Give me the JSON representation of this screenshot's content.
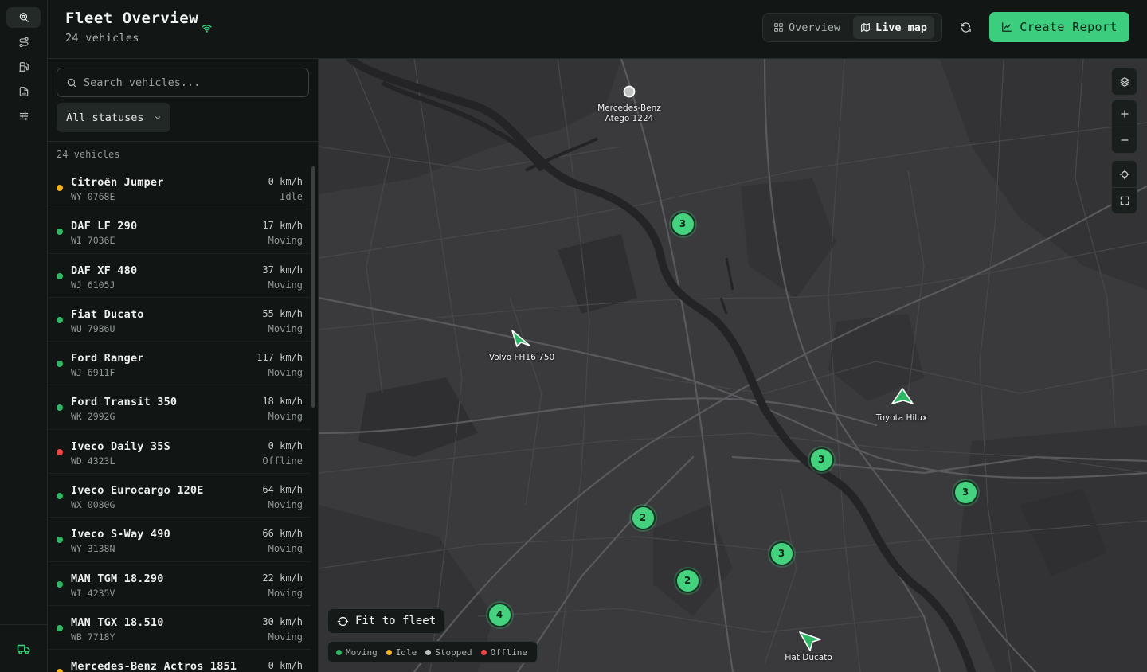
{
  "colors": {
    "accent": "#3ccd7e",
    "moving": "#2fb765",
    "idle": "#f2b31b",
    "stopped": "#bfc4c2",
    "offline": "#ef4444"
  },
  "rail": {
    "items": [
      {
        "icon": "map-pin-icon",
        "active": true
      },
      {
        "icon": "route-icon",
        "active": false
      },
      {
        "icon": "fuel-icon",
        "active": false
      },
      {
        "icon": "document-icon",
        "active": false
      },
      {
        "icon": "sliders-icon",
        "active": false
      }
    ],
    "bottom_icon": "truck-icon"
  },
  "header": {
    "title": "Fleet Overview",
    "live_icon": "wifi-icon",
    "subtitle": "24 vehicles",
    "tabs": [
      {
        "label": "Overview",
        "icon": "grid-icon",
        "active": false
      },
      {
        "label": "Live map",
        "icon": "map-icon",
        "active": true
      }
    ],
    "refresh_icon": "refresh-icon",
    "create_label": "Create Report",
    "create_icon": "chart-icon"
  },
  "sidebar": {
    "search_placeholder": "Search vehicles...",
    "status_filter": "All statuses",
    "count_label": "24 vehicles",
    "vehicles": [
      {
        "name": "Citroën Jumper",
        "plate": "WY 0768E",
        "speed": "0 km/h",
        "status": "Idle",
        "color": "#f2b31b"
      },
      {
        "name": "DAF LF 290",
        "plate": "WI 7036E",
        "speed": "17 km/h",
        "status": "Moving",
        "color": "#2fb765"
      },
      {
        "name": "DAF XF 480",
        "plate": "WJ 6105J",
        "speed": "37 km/h",
        "status": "Moving",
        "color": "#2fb765"
      },
      {
        "name": "Fiat Ducato",
        "plate": "WU 7986U",
        "speed": "55 km/h",
        "status": "Moving",
        "color": "#2fb765"
      },
      {
        "name": "Ford Ranger",
        "plate": "WJ 6911F",
        "speed": "117 km/h",
        "status": "Moving",
        "color": "#2fb765"
      },
      {
        "name": "Ford Transit 350",
        "plate": "WK 2992G",
        "speed": "18 km/h",
        "status": "Moving",
        "color": "#2fb765"
      },
      {
        "name": "Iveco Daily 35S",
        "plate": "WD 4323L",
        "speed": "0 km/h",
        "status": "Offline",
        "color": "#ef4444"
      },
      {
        "name": "Iveco Eurocargo 120E",
        "plate": "WX 0080G",
        "speed": "64 km/h",
        "status": "Moving",
        "color": "#2fb765"
      },
      {
        "name": "Iveco S-Way 490",
        "plate": "WY 3138N",
        "speed": "66 km/h",
        "status": "Moving",
        "color": "#2fb765"
      },
      {
        "name": "MAN TGM 18.290",
        "plate": "WI 4235V",
        "speed": "22 km/h",
        "status": "Moving",
        "color": "#2fb765"
      },
      {
        "name": "MAN TGX 18.510",
        "plate": "WB 7718Y",
        "speed": "30 km/h",
        "status": "Moving",
        "color": "#2fb765"
      },
      {
        "name": "Mercedes-Benz Actros 1851",
        "plate": "",
        "speed": "0 km/h",
        "status": "",
        "color": "#f2b31b"
      }
    ]
  },
  "map": {
    "clusters": [
      "3",
      "3",
      "3",
      "2",
      "3",
      "2",
      "4"
    ],
    "vehicles": [
      "Mercedes-Benz\nAtego 1224",
      "Volvo FH16 750",
      "Toyota Hilux",
      "Fiat Ducato"
    ],
    "controls": [
      "layers-icon",
      "zoom-in-icon",
      "zoom-out-icon",
      "locate-icon",
      "fullscreen-icon"
    ],
    "fit_label": "Fit to fleet",
    "legend": [
      {
        "label": "Moving",
        "color": "#2fb765"
      },
      {
        "label": "Idle",
        "color": "#f2b31b"
      },
      {
        "label": "Stopped",
        "color": "#bfc4c2"
      },
      {
        "label": "Offline",
        "color": "#ef4444"
      }
    ]
  }
}
